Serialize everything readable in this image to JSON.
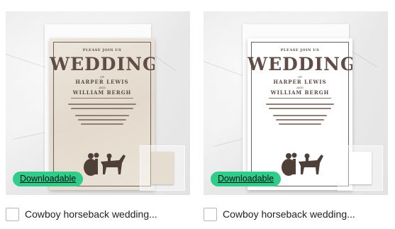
{
  "products": [
    {
      "badge": "Downloadable",
      "title": "Cowboy horseback wedding...",
      "subtitle": "",
      "paper": "kraft",
      "invitation": {
        "please": "PLEASE JOIN US",
        "for_the": "FOR THE",
        "heading": "WEDDING",
        "of": "OF",
        "name1": "HARPER LEWIS",
        "and": "AND",
        "name2": "WILLIAM BERGH",
        "follow": ""
      }
    },
    {
      "badge": "Downloadable",
      "title": "Cowboy horseback wedding...",
      "subtitle": "",
      "paper": "white",
      "invitation": {
        "please": "PLEASE JOIN US",
        "for_the": "FOR THE",
        "heading": "WEDDING",
        "of": "OF",
        "name1": "HARPER LEWIS",
        "and": "AND",
        "name2": "WILLIAM BERGH",
        "follow": ""
      }
    }
  ],
  "colors": {
    "badge_bg": "#2fcc8a",
    "ink": "#5b4a44",
    "kraft_paper": "#e6ddd1"
  },
  "icons": {
    "selection": "checkbox-icon",
    "illustration": "couple-horse-silhouette"
  }
}
